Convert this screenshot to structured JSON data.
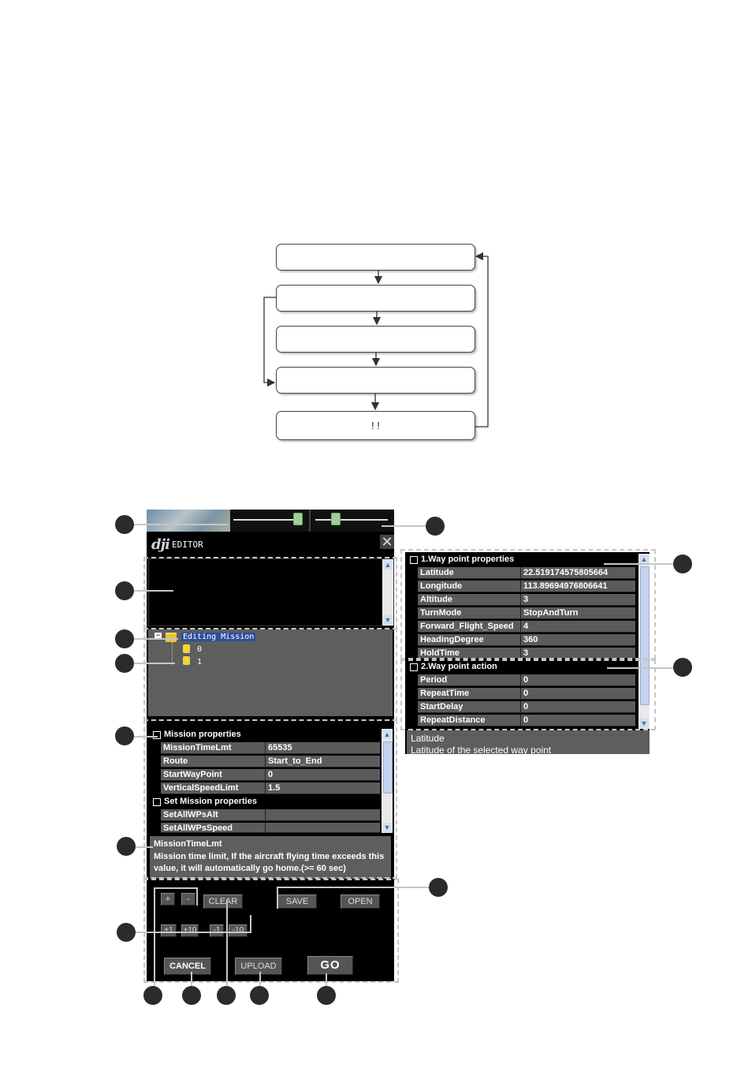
{
  "flowchart": {
    "boxes": [
      "",
      "",
      "",
      "",
      "! !"
    ]
  },
  "editor": {
    "logo": "dji",
    "title": "EDITOR",
    "close_glyph": "✕",
    "tree": {
      "root_label": "Editing Mission",
      "expander": "−",
      "waypoints": [
        "0",
        "1"
      ]
    },
    "mission_grid": {
      "categories": [
        {
          "label": "Mission properties",
          "rows": [
            {
              "name": "MissionTimeLmt",
              "value": "65535"
            },
            {
              "name": "Route",
              "value": "Start_to_End"
            },
            {
              "name": "StartWayPoint",
              "value": "0"
            },
            {
              "name": "VerticalSpeedLimt",
              "value": "1.5"
            }
          ]
        },
        {
          "label": "Set Mission properties",
          "rows": [
            {
              "name": "SetAllWPsAlt",
              "value": ""
            },
            {
              "name": "SetAllWPsSpeed",
              "value": ""
            }
          ]
        }
      ]
    },
    "help": {
      "title": "MissionTimeLmt",
      "text": "Mission time limit, If the aircraft flying time exceeds this value, it will automatically go home.(>= 60 sec)"
    },
    "buttons": {
      "plus": "+",
      "minus": "-",
      "clear": "CLEAR",
      "save": "SAVE",
      "open": "OPEN",
      "plus1": "+1",
      "plus10": "+10",
      "minus1": "-1",
      "minus10": "-10",
      "cancel": "CANCEL",
      "upload": "UPLOAD",
      "go": "GO"
    }
  },
  "waypoint_panel": {
    "categories": [
      {
        "label": "1.Way point properties",
        "rows": [
          {
            "name": "Latitude",
            "value": "22.519174575805664"
          },
          {
            "name": "Longitude",
            "value": "113.89694976806641"
          },
          {
            "name": "Altitude",
            "value": "3"
          },
          {
            "name": "TurnMode",
            "value": "StopAndTurn"
          },
          {
            "name": "Forward_Flight_Speed",
            "value": "4"
          },
          {
            "name": "HeadingDegree",
            "value": "360"
          },
          {
            "name": "HoldTime",
            "value": "3"
          }
        ]
      },
      {
        "label": "2.Way point action",
        "rows": [
          {
            "name": "Period",
            "value": "0"
          },
          {
            "name": "RepeatTime",
            "value": "0"
          },
          {
            "name": "StartDelay",
            "value": "0"
          },
          {
            "name": "RepeatDistance",
            "value": "0"
          }
        ]
      }
    ],
    "help": {
      "title": "Latitude",
      "text": "Latitude of the selected way point"
    }
  },
  "colors": {
    "editor_bg": "#000000",
    "panel_gray": "#5e5e5e",
    "row_gray": "#5b5b5b",
    "selection_blue": "#2c4f9c",
    "callout": "#2b2b2b",
    "dashed_frame": "#c6c6c6"
  }
}
